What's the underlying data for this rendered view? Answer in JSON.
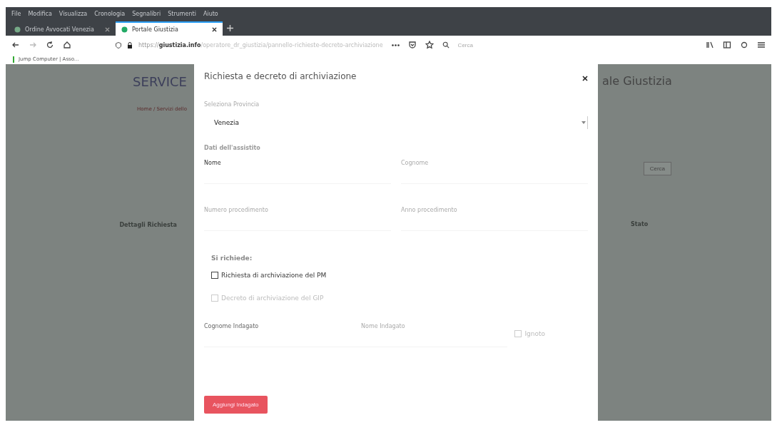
{
  "menu": [
    "File",
    "Modifica",
    "Visualizza",
    "Cronologia",
    "Segnalibri",
    "Strumenti",
    "Aiuto"
  ],
  "tabs": [
    {
      "label": "Ordine Avvocati Venezia",
      "selected": false
    },
    {
      "label": "Portale Giustizia",
      "selected": true
    }
  ],
  "address": {
    "scheme": "https://",
    "host": "giustizia.info",
    "path": "/operatore_dr_giustizia/pannello-richieste-decreto-archiviazione"
  },
  "search": {
    "placeholder": "Cerca"
  },
  "bookmarks": [
    "Jump Computer | Asso..."
  ],
  "background": {
    "logo": "SERVICE",
    "title": "ale Giustizia",
    "breadcrumb": "Home / Servizi dello",
    "button": "Cerca",
    "column_1": "Dettagli Richiesta",
    "column_2": "Stato"
  },
  "modal": {
    "title": "Richiesta e decreto di archiviazione",
    "province_label": "Seleziona Provincia",
    "province_value": "Venezia",
    "section": "Dati dell'assistito",
    "fields": [
      {
        "label": "Nome"
      },
      {
        "label": "Cognome"
      },
      {
        "label": "Numero procedimento"
      },
      {
        "label": "Anno procedimento"
      }
    ],
    "request_label": "Si richiede:",
    "options": [
      {
        "label": "Richiesta di archiviazione del PM",
        "checked": false,
        "disabled": false
      },
      {
        "label": "Decreto di archiviazione del GIP",
        "checked": false,
        "disabled": true
      }
    ],
    "suspect_fields": [
      {
        "label": "Cognome Indagato"
      },
      {
        "label": "Nome Indagato"
      }
    ],
    "unknown": {
      "label": "Ignoto",
      "checked": false
    },
    "add_button": "Aggiungi Indagato"
  }
}
